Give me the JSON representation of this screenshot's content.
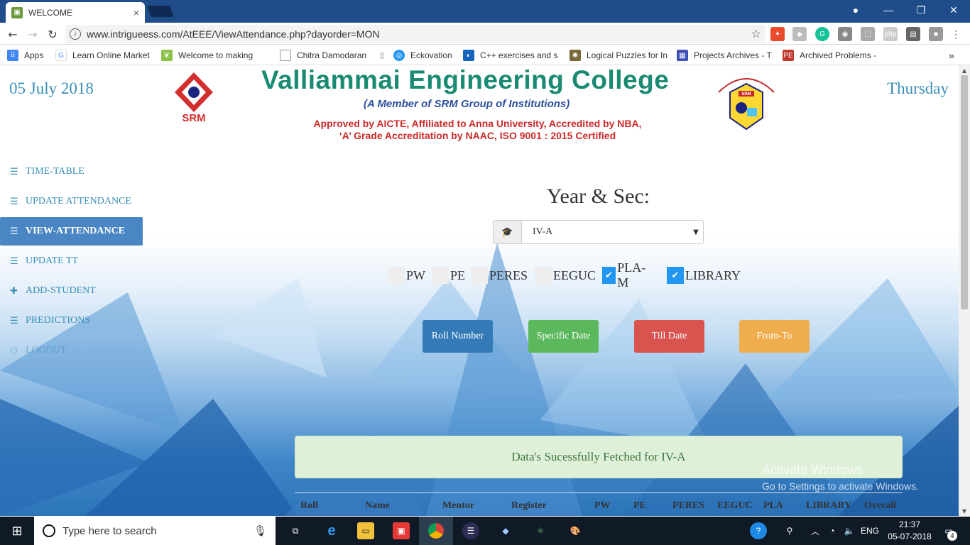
{
  "browser": {
    "tab_title": "WELCOME",
    "tab_close": "×",
    "url": "www.intrigueess.com/AtEEE/ViewAttendance.php?dayorder=MON",
    "window_controls": [
      "minimize",
      "restore",
      "close"
    ],
    "bookmarks": [
      {
        "label": "Apps",
        "icon": "apps-grid-icon"
      },
      {
        "label": "Learn Online Market",
        "icon": "google-icon"
      },
      {
        "label": "Welcome to making",
        "icon": "leaf-icon"
      },
      {
        "label": "Chitra Damodaran",
        "icon": "page-icon"
      },
      {
        "label": "Eckovation",
        "icon": "eckovation-icon"
      },
      {
        "label": "C++ exercises and s",
        "icon": "cpp-icon"
      },
      {
        "label": "Logical Puzzles for In",
        "icon": "puzzle-icon"
      },
      {
        "label": "Projects Archives - T",
        "icon": "grid-icon"
      },
      {
        "label": "Archived Problems -",
        "icon": "pe-icon"
      }
    ],
    "more_bookmarks": "»"
  },
  "header": {
    "date": "05 July 2018",
    "day": "Thursday",
    "college_name": "Valliammai Engineering College",
    "college_subtitle": "(A Member of SRM Group of Institutions)",
    "approval_line1": "Approved by AICTE, Affiliated to Anna University, Accredited by NBA,",
    "approval_line2": "‘A’ Grade Accreditation by NAAC, ISO 9001 : 2015 Certified",
    "srm_logo_text": "SRM",
    "vec_logo_text": "SRM"
  },
  "sidebar": {
    "items": [
      {
        "label": "TIME-TABLE",
        "icon": "list-icon",
        "active": false
      },
      {
        "label": "UPDATE ATTENDANCE",
        "icon": "list-icon",
        "active": false
      },
      {
        "label": "VIEW-ATTENDANCE",
        "icon": "list-icon",
        "active": true
      },
      {
        "label": "UPDATE TT",
        "icon": "list-icon",
        "active": false
      },
      {
        "label": "ADD-STUDENT",
        "icon": "plus-icon",
        "active": false
      },
      {
        "label": "PREDICTIONS",
        "icon": "list-icon",
        "active": false
      },
      {
        "label": "LOGOUT",
        "icon": "power-icon",
        "active": false
      }
    ]
  },
  "main": {
    "year_label": "Year & Sec:",
    "year_select_value": "IV-A",
    "subjects": [
      {
        "label": "PW",
        "checked": false
      },
      {
        "label": "PE",
        "checked": false
      },
      {
        "label": "PERES",
        "checked": false
      },
      {
        "label": "EEGUC",
        "checked": false
      },
      {
        "label": "PLA-M",
        "checked": true
      },
      {
        "label": "LIBRARY",
        "checked": true
      }
    ],
    "buttons": [
      {
        "label": "Roll Number",
        "color": "#337ab7"
      },
      {
        "label": "Specific Date",
        "color": "#5cb85c"
      },
      {
        "label": "Till Date",
        "color": "#d9534f"
      },
      {
        "label": "From-To",
        "color": "#f0ad4e"
      }
    ],
    "alert": "Data's Sucessfully Fetched for IV-A",
    "table_headers": [
      "Roll",
      "Name",
      "Mentor",
      "Register",
      "PW",
      "PE",
      "PERES",
      "EEGUC",
      "PLA",
      "LIBRARY",
      "Overall"
    ]
  },
  "watermark": {
    "line1": "Activate Windows",
    "line2": "Go to Settings to activate Windows."
  },
  "taskbar": {
    "search_placeholder": "Type here to search",
    "language": "ENG",
    "time": "21:37",
    "date": "05-07-2018",
    "notification_count": "4"
  }
}
